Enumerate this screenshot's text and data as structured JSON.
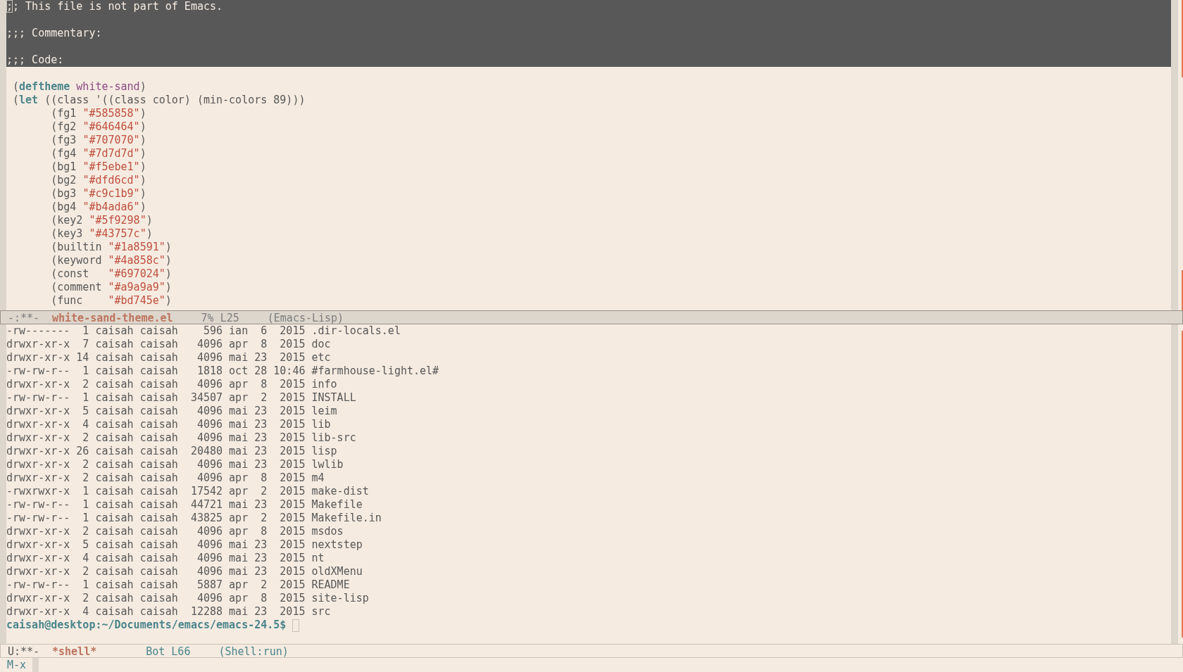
{
  "file_window": {
    "lines": [
      {
        "highlighted": true,
        "tokens": [
          {
            "text": ";",
            "kind": "cursor"
          },
          {
            "text": "; This file is not part of Emacs.",
            "kind": "comment"
          }
        ]
      },
      {
        "highlighted": true,
        "gap_before": true,
        "tokens": [
          {
            "text": ";;; Commentary:",
            "kind": "comment"
          }
        ]
      },
      {
        "highlighted": true,
        "gap_before": true,
        "tokens": [
          {
            "text": ";;; Code:",
            "kind": "comment"
          }
        ]
      },
      {
        "highlighted": false,
        "gap_before": true,
        "tokens": [
          {
            "text": " (",
            "kind": "plain"
          },
          {
            "text": "deftheme",
            "kind": "keyword"
          },
          {
            "text": " white-sand",
            "kind": "name"
          },
          {
            "text": ")",
            "kind": "plain"
          }
        ]
      },
      {
        "highlighted": false,
        "tokens": [
          {
            "text": " (",
            "kind": "plain"
          },
          {
            "text": "let",
            "kind": "keyword"
          },
          {
            "text": " ((class '((class color) (min-colors 89)))",
            "kind": "plain"
          }
        ]
      },
      {
        "highlighted": false,
        "tokens": [
          {
            "text": "       (fg1 ",
            "kind": "plain"
          },
          {
            "text": "\"#585858\"",
            "kind": "string"
          },
          {
            "text": ")",
            "kind": "plain"
          }
        ]
      },
      {
        "highlighted": false,
        "tokens": [
          {
            "text": "       (fg2 ",
            "kind": "plain"
          },
          {
            "text": "\"#646464\"",
            "kind": "string"
          },
          {
            "text": ")",
            "kind": "plain"
          }
        ]
      },
      {
        "highlighted": false,
        "tokens": [
          {
            "text": "       (fg3 ",
            "kind": "plain"
          },
          {
            "text": "\"#707070\"",
            "kind": "string"
          },
          {
            "text": ")",
            "kind": "plain"
          }
        ]
      },
      {
        "highlighted": false,
        "tokens": [
          {
            "text": "       (fg4 ",
            "kind": "plain"
          },
          {
            "text": "\"#7d7d7d\"",
            "kind": "string"
          },
          {
            "text": ")",
            "kind": "plain"
          }
        ]
      },
      {
        "highlighted": false,
        "tokens": [
          {
            "text": "       (bg1 ",
            "kind": "plain"
          },
          {
            "text": "\"#f5ebe1\"",
            "kind": "string"
          },
          {
            "text": ")",
            "kind": "plain"
          }
        ]
      },
      {
        "highlighted": false,
        "tokens": [
          {
            "text": "       (bg2 ",
            "kind": "plain"
          },
          {
            "text": "\"#dfd6cd\"",
            "kind": "string"
          },
          {
            "text": ")",
            "kind": "plain"
          }
        ]
      },
      {
        "highlighted": false,
        "tokens": [
          {
            "text": "       (bg3 ",
            "kind": "plain"
          },
          {
            "text": "\"#c9c1b9\"",
            "kind": "string"
          },
          {
            "text": ")",
            "kind": "plain"
          }
        ]
      },
      {
        "highlighted": false,
        "tokens": [
          {
            "text": "       (bg4 ",
            "kind": "plain"
          },
          {
            "text": "\"#b4ada6\"",
            "kind": "string"
          },
          {
            "text": ")",
            "kind": "plain"
          }
        ]
      },
      {
        "highlighted": false,
        "tokens": [
          {
            "text": "       (key2 ",
            "kind": "plain"
          },
          {
            "text": "\"#5f9298\"",
            "kind": "string"
          },
          {
            "text": ")",
            "kind": "plain"
          }
        ]
      },
      {
        "highlighted": false,
        "tokens": [
          {
            "text": "       (key3 ",
            "kind": "plain"
          },
          {
            "text": "\"#43757c\"",
            "kind": "string"
          },
          {
            "text": ")",
            "kind": "plain"
          }
        ]
      },
      {
        "highlighted": false,
        "tokens": [
          {
            "text": "       (builtin ",
            "kind": "plain"
          },
          {
            "text": "\"#1a8591\"",
            "kind": "string"
          },
          {
            "text": ")",
            "kind": "plain"
          }
        ]
      },
      {
        "highlighted": false,
        "tokens": [
          {
            "text": "       (keyword ",
            "kind": "plain"
          },
          {
            "text": "\"#4a858c\"",
            "kind": "string"
          },
          {
            "text": ")",
            "kind": "plain"
          }
        ]
      },
      {
        "highlighted": false,
        "tokens": [
          {
            "text": "       (const   ",
            "kind": "plain"
          },
          {
            "text": "\"#697024\"",
            "kind": "string"
          },
          {
            "text": ")",
            "kind": "plain"
          }
        ]
      },
      {
        "highlighted": false,
        "tokens": [
          {
            "text": "       (comment ",
            "kind": "plain"
          },
          {
            "text": "\"#a9a9a9\"",
            "kind": "string"
          },
          {
            "text": ")",
            "kind": "plain"
          }
        ]
      },
      {
        "highlighted": false,
        "tokens": [
          {
            "text": "       (func    ",
            "kind": "plain"
          },
          {
            "text": "\"#bd745e\"",
            "kind": "string"
          },
          {
            "text": ")",
            "kind": "plain"
          }
        ]
      }
    ],
    "mode_line": {
      "active": true,
      "status": "-:**-",
      "buffer": "white-sand-theme.el",
      "position": "7% L25",
      "mode": "(Emacs-Lisp)"
    }
  },
  "shell_window": {
    "lines": [
      "-rw-------  1 caisah caisah    596 ian  6  2015 .dir-locals.el",
      "drwxr-xr-x  7 caisah caisah   4096 apr  8  2015 doc",
      "drwxr-xr-x 14 caisah caisah   4096 mai 23  2015 etc",
      "-rw-rw-r--  1 caisah caisah   1818 oct 28 10:46 #farmhouse-light.el#",
      "drwxr-xr-x  2 caisah caisah   4096 apr  8  2015 info",
      "-rw-rw-r--  1 caisah caisah  34507 apr  2  2015 INSTALL",
      "drwxr-xr-x  5 caisah caisah   4096 mai 23  2015 leim",
      "drwxr-xr-x  4 caisah caisah   4096 mai 23  2015 lib",
      "drwxr-xr-x  2 caisah caisah   4096 mai 23  2015 lib-src",
      "drwxr-xr-x 26 caisah caisah  20480 mai 23  2015 lisp",
      "drwxr-xr-x  2 caisah caisah   4096 mai 23  2015 lwlib",
      "drwxr-xr-x  2 caisah caisah   4096 apr  8  2015 m4",
      "-rwxrwxr-x  1 caisah caisah  17542 apr  2  2015 make-dist",
      "-rw-rw-r--  1 caisah caisah  44721 mai 23  2015 Makefile",
      "-rw-rw-r--  1 caisah caisah  43825 apr  2  2015 Makefile.in",
      "drwxr-xr-x  2 caisah caisah   4096 apr  8  2015 msdos",
      "drwxr-xr-x  5 caisah caisah   4096 mai 23  2015 nextstep",
      "drwxr-xr-x  4 caisah caisah   4096 mai 23  2015 nt",
      "drwxr-xr-x  2 caisah caisah   4096 mai 23  2015 oldXMenu",
      "-rw-rw-r--  1 caisah caisah   5887 apr  2  2015 README",
      "drwxr-xr-x  2 caisah caisah   4096 apr  8  2015 site-lisp",
      "drwxr-xr-x  4 caisah caisah  12288 mai 23  2015 src"
    ],
    "prompt": "caisah@desktop:~/Documents/emacs/emacs-24.5$",
    "mode_line": {
      "active": false,
      "status": "U:**-",
      "buffer": "*shell*",
      "position": "Bot L66",
      "mode": "(Shell:run)"
    }
  },
  "minibuffer": {
    "text": "M-x"
  }
}
